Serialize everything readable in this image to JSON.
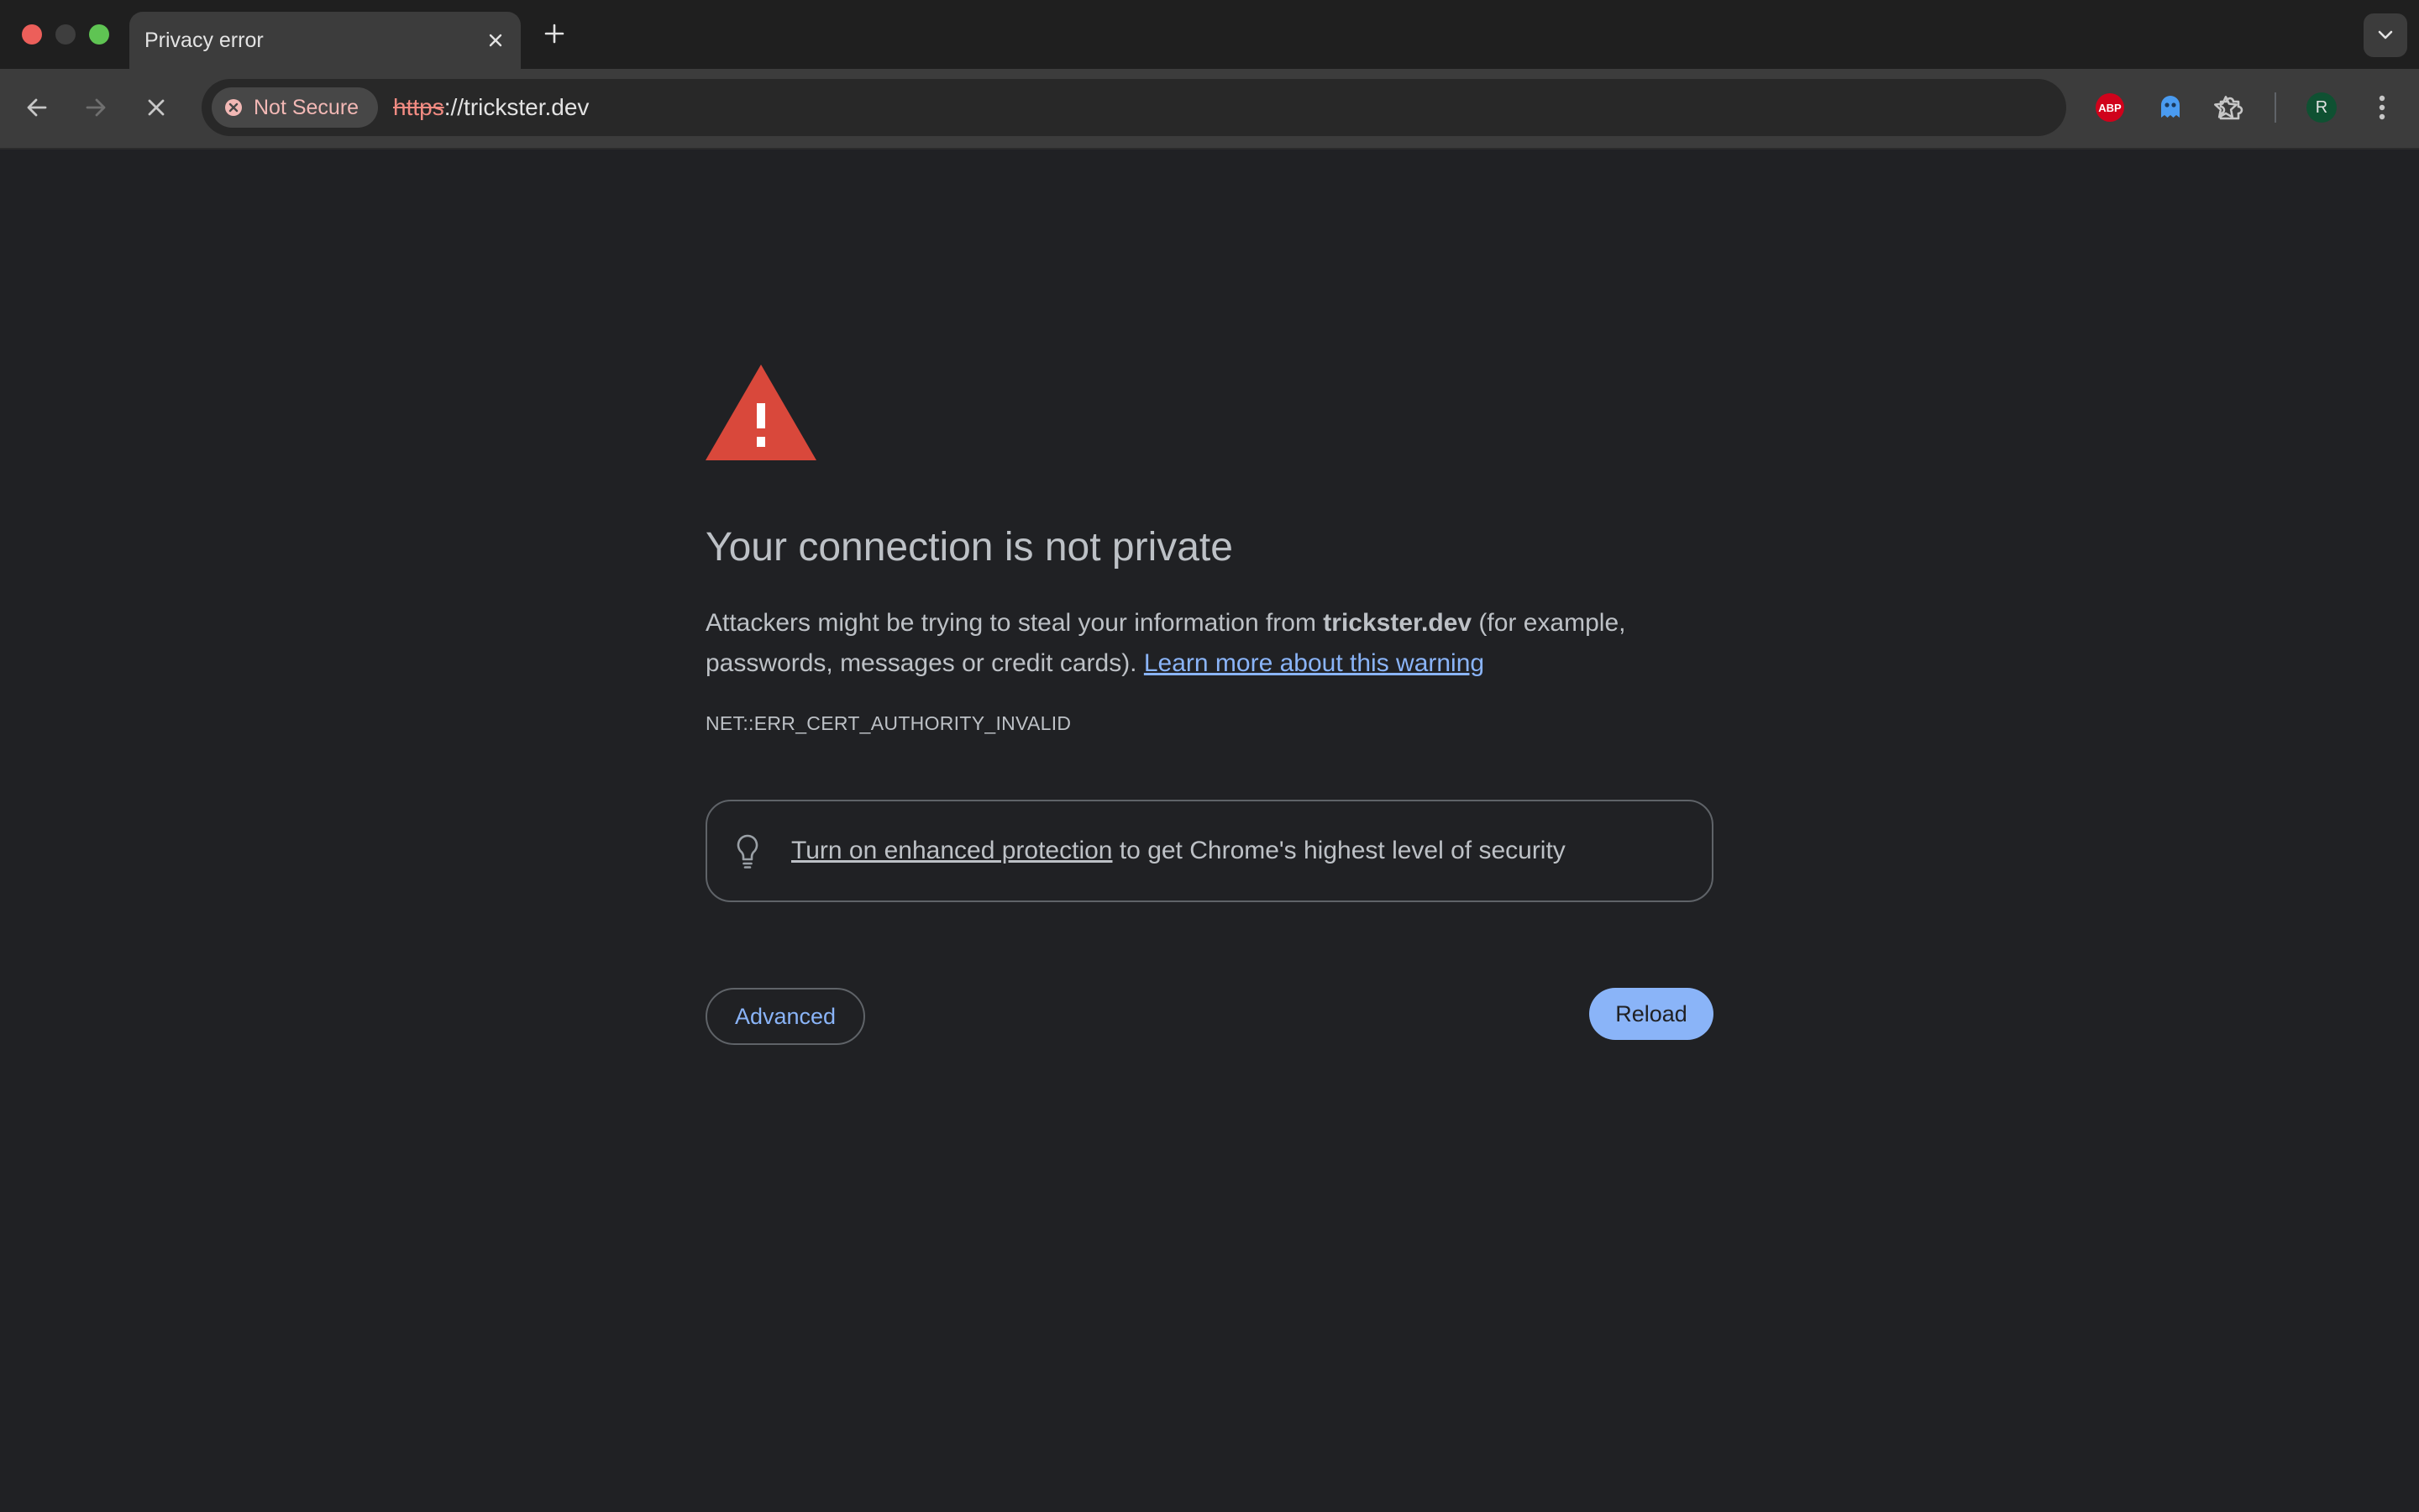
{
  "browser": {
    "window_controls": [
      "close",
      "minimize",
      "zoom"
    ],
    "tab": {
      "title": "Privacy error",
      "close_icon": "close-icon"
    },
    "new_tab_icon": "plus-icon",
    "tab_search_icon": "chevron-down-icon",
    "toolbar": {
      "back_icon": "arrow-left-icon",
      "forward_icon": "arrow-right-icon",
      "stop_icon": "close-icon",
      "security_chip": {
        "label": "Not Secure",
        "icon": "error-circle-icon",
        "color": "#f2b8b5"
      },
      "url": {
        "scheme": "https",
        "rest": "://trickster.dev"
      },
      "bookmark_icon": "star-icon",
      "extensions": [
        {
          "name": "adblock-plus",
          "badge": "ABP"
        },
        {
          "name": "ghostery",
          "icon": "ghost-icon"
        },
        {
          "name": "extensions-menu",
          "icon": "puzzle-icon"
        }
      ],
      "profile_initial": "R",
      "menu_icon": "kebab-menu-icon"
    }
  },
  "interstitial": {
    "heading": "Your connection is not private",
    "body_prefix": "Attackers might be trying to steal your information from ",
    "domain": "trickster.dev",
    "body_suffix": " (for example, passwords, messages or credit cards). ",
    "learn_more": "Learn more about this warning",
    "error_code": "NET::ERR_CERT_AUTHORITY_INVALID",
    "enhanced_protection_link": "Turn on enhanced protection",
    "enhanced_protection_suffix": " to get Chrome's highest level of security",
    "advanced_label": "Advanced",
    "reload_label": "Reload"
  },
  "colors": {
    "page_bg": "#202124",
    "text": "#bdc1c6",
    "link": "#8ab4f8",
    "warning": "#d9483b",
    "primary_button": "#8ab4f8"
  }
}
